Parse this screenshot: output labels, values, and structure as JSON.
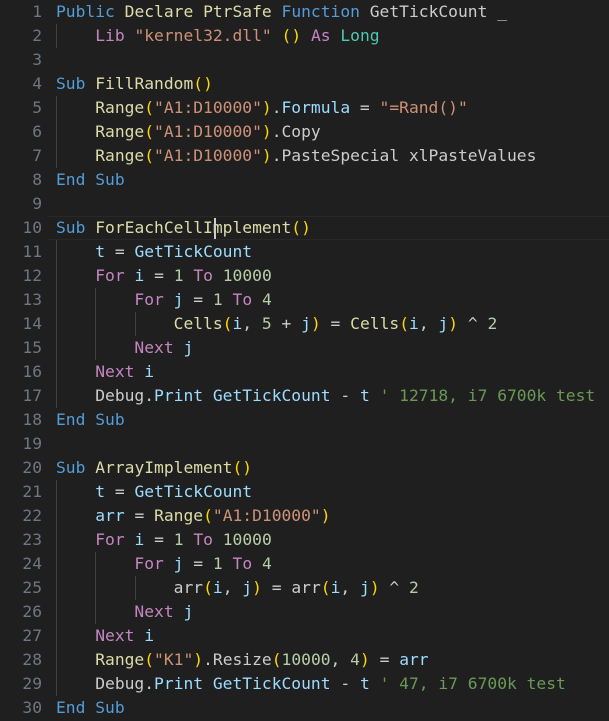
{
  "editor": {
    "background": "#1f1f1f",
    "line_number_color": "#6e7681",
    "caret": {
      "line": 10,
      "column": 16,
      "visible": true
    },
    "active_line": 10,
    "total_visible_lines": 30,
    "language": "vba",
    "colors": {
      "keyword_blue": "#569cd6",
      "keyword_pink": "#c586c0",
      "function_yellow": "#dcdcaa",
      "type_teal": "#4ec9b0",
      "string_orange": "#ce9178",
      "number_green": "#b5cea8",
      "variable_blue": "#9cdcfe",
      "comment_green": "#6a9955",
      "plain": "#cccccc",
      "bracket1": "#ffd700",
      "bracket2": "#da70d6",
      "bracket3": "#179fff"
    },
    "lines": [
      {
        "n": "1",
        "indent": 0,
        "text": "Public Declare PtrSafe Function GetTickCount _"
      },
      {
        "n": "2",
        "indent": 1,
        "text": "    Lib \"kernel32.dll\" () As Long"
      },
      {
        "n": "3",
        "indent": 0,
        "text": ""
      },
      {
        "n": "4",
        "indent": 0,
        "text": "Sub FillRandom()"
      },
      {
        "n": "5",
        "indent": 1,
        "text": "    Range(\"A1:D10000\").Formula = \"=Rand()\""
      },
      {
        "n": "6",
        "indent": 1,
        "text": "    Range(\"A1:D10000\").Copy"
      },
      {
        "n": "7",
        "indent": 1,
        "text": "    Range(\"A1:D10000\").PasteSpecial xlPasteValues"
      },
      {
        "n": "8",
        "indent": 0,
        "text": "End Sub"
      },
      {
        "n": "9",
        "indent": 0,
        "text": ""
      },
      {
        "n": "10",
        "indent": 0,
        "text": "Sub ForEachCellImplement()"
      },
      {
        "n": "11",
        "indent": 1,
        "text": "    t = GetTickCount"
      },
      {
        "n": "12",
        "indent": 1,
        "text": "    For i = 1 To 10000"
      },
      {
        "n": "13",
        "indent": 2,
        "text": "        For j = 1 To 4"
      },
      {
        "n": "14",
        "indent": 3,
        "text": "            Cells(i, 5 + j) = Cells(i, j) ^ 2"
      },
      {
        "n": "15",
        "indent": 2,
        "text": "        Next j"
      },
      {
        "n": "16",
        "indent": 1,
        "text": "    Next i"
      },
      {
        "n": "17",
        "indent": 1,
        "text": "    Debug.Print GetTickCount - t ' 12718, i7 6700k test"
      },
      {
        "n": "18",
        "indent": 0,
        "text": "End Sub"
      },
      {
        "n": "19",
        "indent": 0,
        "text": ""
      },
      {
        "n": "20",
        "indent": 0,
        "text": "Sub ArrayImplement()"
      },
      {
        "n": "21",
        "indent": 1,
        "text": "    t = GetTickCount"
      },
      {
        "n": "22",
        "indent": 1,
        "text": "    arr = Range(\"A1:D10000\")"
      },
      {
        "n": "23",
        "indent": 1,
        "text": "    For i = 1 To 10000"
      },
      {
        "n": "24",
        "indent": 2,
        "text": "        For j = 1 To 4"
      },
      {
        "n": "25",
        "indent": 3,
        "text": "            arr(i, j) = arr(i, j) ^ 2"
      },
      {
        "n": "26",
        "indent": 2,
        "text": "        Next j"
      },
      {
        "n": "27",
        "indent": 1,
        "text": "    Next i"
      },
      {
        "n": "28",
        "indent": 1,
        "text": "    Range(\"K1\").Resize(10000, 4) = arr"
      },
      {
        "n": "29",
        "indent": 1,
        "text": "    Debug.Print GetTickCount - t ' 47, i7 6700k test"
      },
      {
        "n": "30",
        "indent": 0,
        "text": "End Sub"
      }
    ],
    "tokens": [
      [
        {
          "t": "Public",
          "c": "kw"
        },
        {
          "t": " ",
          "c": "plain"
        },
        {
          "t": "Declare",
          "c": "fn"
        },
        {
          "t": " ",
          "c": "plain"
        },
        {
          "t": "PtrSafe",
          "c": "fn"
        },
        {
          "t": " ",
          "c": "plain"
        },
        {
          "t": "Function",
          "c": "kw"
        },
        {
          "t": " ",
          "c": "plain"
        },
        {
          "t": "GetTickCount",
          "c": "plain"
        },
        {
          "t": " ",
          "c": "plain"
        },
        {
          "t": "_",
          "c": "plain"
        }
      ],
      [
        {
          "t": "    ",
          "c": "plain"
        },
        {
          "t": "Lib",
          "c": "kw2"
        },
        {
          "t": " ",
          "c": "plain"
        },
        {
          "t": "\"kernel32.dll\"",
          "c": "str"
        },
        {
          "t": " ",
          "c": "plain"
        },
        {
          "t": "(",
          "c": "p1"
        },
        {
          "t": ")",
          "c": "p1"
        },
        {
          "t": " ",
          "c": "plain"
        },
        {
          "t": "As",
          "c": "kw2"
        },
        {
          "t": " ",
          "c": "plain"
        },
        {
          "t": "Long",
          "c": "type"
        }
      ],
      [],
      [
        {
          "t": "Sub",
          "c": "kw"
        },
        {
          "t": " ",
          "c": "plain"
        },
        {
          "t": "FillRandom",
          "c": "fn"
        },
        {
          "t": "(",
          "c": "p1"
        },
        {
          "t": ")",
          "c": "p1"
        }
      ],
      [
        {
          "t": "    ",
          "c": "plain"
        },
        {
          "t": "Range",
          "c": "fn"
        },
        {
          "t": "(",
          "c": "p1"
        },
        {
          "t": "\"A1:D10000\"",
          "c": "str"
        },
        {
          "t": ")",
          "c": "p1"
        },
        {
          "t": ".",
          "c": "plain"
        },
        {
          "t": "Formula",
          "c": "var"
        },
        {
          "t": " = ",
          "c": "plain"
        },
        {
          "t": "\"=Rand()\"",
          "c": "str"
        }
      ],
      [
        {
          "t": "    ",
          "c": "plain"
        },
        {
          "t": "Range",
          "c": "fn"
        },
        {
          "t": "(",
          "c": "p1"
        },
        {
          "t": "\"A1:D10000\"",
          "c": "str"
        },
        {
          "t": ")",
          "c": "p1"
        },
        {
          "t": ".",
          "c": "plain"
        },
        {
          "t": "Copy",
          "c": "plain"
        }
      ],
      [
        {
          "t": "    ",
          "c": "plain"
        },
        {
          "t": "Range",
          "c": "fn"
        },
        {
          "t": "(",
          "c": "p1"
        },
        {
          "t": "\"A1:D10000\"",
          "c": "str"
        },
        {
          "t": ")",
          "c": "p1"
        },
        {
          "t": ".",
          "c": "plain"
        },
        {
          "t": "PasteSpecial",
          "c": "plain"
        },
        {
          "t": " ",
          "c": "plain"
        },
        {
          "t": "xlPasteValues",
          "c": "plain"
        }
      ],
      [
        {
          "t": "End",
          "c": "kw"
        },
        {
          "t": " ",
          "c": "plain"
        },
        {
          "t": "Sub",
          "c": "kw"
        }
      ],
      [],
      [
        {
          "t": "Sub",
          "c": "kw"
        },
        {
          "t": " ",
          "c": "plain"
        },
        {
          "t": "ForEachCellImplement",
          "c": "fn"
        },
        {
          "t": "(",
          "c": "p1"
        },
        {
          "t": ")",
          "c": "p1"
        }
      ],
      [
        {
          "t": "    ",
          "c": "plain"
        },
        {
          "t": "t",
          "c": "var"
        },
        {
          "t": " = ",
          "c": "plain"
        },
        {
          "t": "GetTickCount",
          "c": "var"
        }
      ],
      [
        {
          "t": "    ",
          "c": "plain"
        },
        {
          "t": "For",
          "c": "kw2"
        },
        {
          "t": " ",
          "c": "plain"
        },
        {
          "t": "i",
          "c": "var"
        },
        {
          "t": " = ",
          "c": "plain"
        },
        {
          "t": "1",
          "c": "num"
        },
        {
          "t": " ",
          "c": "plain"
        },
        {
          "t": "To",
          "c": "kw2"
        },
        {
          "t": " ",
          "c": "plain"
        },
        {
          "t": "10000",
          "c": "num"
        }
      ],
      [
        {
          "t": "        ",
          "c": "plain"
        },
        {
          "t": "For",
          "c": "kw2"
        },
        {
          "t": " ",
          "c": "plain"
        },
        {
          "t": "j",
          "c": "var"
        },
        {
          "t": " = ",
          "c": "plain"
        },
        {
          "t": "1",
          "c": "num"
        },
        {
          "t": " ",
          "c": "plain"
        },
        {
          "t": "To",
          "c": "kw2"
        },
        {
          "t": " ",
          "c": "plain"
        },
        {
          "t": "4",
          "c": "num"
        }
      ],
      [
        {
          "t": "            ",
          "c": "plain"
        },
        {
          "t": "Cells",
          "c": "fn"
        },
        {
          "t": "(",
          "c": "p1"
        },
        {
          "t": "i",
          "c": "var"
        },
        {
          "t": ", ",
          "c": "plain"
        },
        {
          "t": "5",
          "c": "num"
        },
        {
          "t": " + ",
          "c": "plain"
        },
        {
          "t": "j",
          "c": "var"
        },
        {
          "t": ")",
          "c": "p1"
        },
        {
          "t": " = ",
          "c": "plain"
        },
        {
          "t": "Cells",
          "c": "fn"
        },
        {
          "t": "(",
          "c": "p1"
        },
        {
          "t": "i",
          "c": "var"
        },
        {
          "t": ", ",
          "c": "plain"
        },
        {
          "t": "j",
          "c": "var"
        },
        {
          "t": ")",
          "c": "p1"
        },
        {
          "t": " ^ ",
          "c": "plain"
        },
        {
          "t": "2",
          "c": "num"
        }
      ],
      [
        {
          "t": "        ",
          "c": "plain"
        },
        {
          "t": "Next",
          "c": "kw2"
        },
        {
          "t": " ",
          "c": "plain"
        },
        {
          "t": "j",
          "c": "var"
        }
      ],
      [
        {
          "t": "    ",
          "c": "plain"
        },
        {
          "t": "Next",
          "c": "kw2"
        },
        {
          "t": " ",
          "c": "plain"
        },
        {
          "t": "i",
          "c": "var"
        }
      ],
      [
        {
          "t": "    ",
          "c": "plain"
        },
        {
          "t": "Debug",
          "c": "plain"
        },
        {
          "t": ".",
          "c": "plain"
        },
        {
          "t": "Print",
          "c": "var"
        },
        {
          "t": " ",
          "c": "plain"
        },
        {
          "t": "GetTickCount",
          "c": "var"
        },
        {
          "t": " - ",
          "c": "plain"
        },
        {
          "t": "t",
          "c": "var"
        },
        {
          "t": " ",
          "c": "plain"
        },
        {
          "t": "' 12718, i7 6700k test",
          "c": "cmt"
        }
      ],
      [
        {
          "t": "End",
          "c": "kw"
        },
        {
          "t": " ",
          "c": "plain"
        },
        {
          "t": "Sub",
          "c": "kw"
        }
      ],
      [],
      [
        {
          "t": "Sub",
          "c": "kw"
        },
        {
          "t": " ",
          "c": "plain"
        },
        {
          "t": "ArrayImplement",
          "c": "fn"
        },
        {
          "t": "(",
          "c": "p1"
        },
        {
          "t": ")",
          "c": "p1"
        }
      ],
      [
        {
          "t": "    ",
          "c": "plain"
        },
        {
          "t": "t",
          "c": "var"
        },
        {
          "t": " = ",
          "c": "plain"
        },
        {
          "t": "GetTickCount",
          "c": "var"
        }
      ],
      [
        {
          "t": "    ",
          "c": "plain"
        },
        {
          "t": "arr",
          "c": "var"
        },
        {
          "t": " = ",
          "c": "plain"
        },
        {
          "t": "Range",
          "c": "fn"
        },
        {
          "t": "(",
          "c": "p1"
        },
        {
          "t": "\"A1:D10000\"",
          "c": "str"
        },
        {
          "t": ")",
          "c": "p1"
        }
      ],
      [
        {
          "t": "    ",
          "c": "plain"
        },
        {
          "t": "For",
          "c": "kw2"
        },
        {
          "t": " ",
          "c": "plain"
        },
        {
          "t": "i",
          "c": "var"
        },
        {
          "t": " = ",
          "c": "plain"
        },
        {
          "t": "1",
          "c": "num"
        },
        {
          "t": " ",
          "c": "plain"
        },
        {
          "t": "To",
          "c": "kw2"
        },
        {
          "t": " ",
          "c": "plain"
        },
        {
          "t": "10000",
          "c": "num"
        }
      ],
      [
        {
          "t": "        ",
          "c": "plain"
        },
        {
          "t": "For",
          "c": "kw2"
        },
        {
          "t": " ",
          "c": "plain"
        },
        {
          "t": "j",
          "c": "var"
        },
        {
          "t": " = ",
          "c": "plain"
        },
        {
          "t": "1",
          "c": "num"
        },
        {
          "t": " ",
          "c": "plain"
        },
        {
          "t": "To",
          "c": "kw2"
        },
        {
          "t": " ",
          "c": "plain"
        },
        {
          "t": "4",
          "c": "num"
        }
      ],
      [
        {
          "t": "            ",
          "c": "plain"
        },
        {
          "t": "arr",
          "c": "plain"
        },
        {
          "t": "(",
          "c": "p1"
        },
        {
          "t": "i",
          "c": "var"
        },
        {
          "t": ", ",
          "c": "plain"
        },
        {
          "t": "j",
          "c": "var"
        },
        {
          "t": ")",
          "c": "p1"
        },
        {
          "t": " = ",
          "c": "plain"
        },
        {
          "t": "arr",
          "c": "plain"
        },
        {
          "t": "(",
          "c": "p1"
        },
        {
          "t": "i",
          "c": "var"
        },
        {
          "t": ", ",
          "c": "plain"
        },
        {
          "t": "j",
          "c": "var"
        },
        {
          "t": ")",
          "c": "p1"
        },
        {
          "t": " ^ ",
          "c": "plain"
        },
        {
          "t": "2",
          "c": "num"
        }
      ],
      [
        {
          "t": "        ",
          "c": "plain"
        },
        {
          "t": "Next",
          "c": "kw2"
        },
        {
          "t": " ",
          "c": "plain"
        },
        {
          "t": "j",
          "c": "var"
        }
      ],
      [
        {
          "t": "    ",
          "c": "plain"
        },
        {
          "t": "Next",
          "c": "kw2"
        },
        {
          "t": " ",
          "c": "plain"
        },
        {
          "t": "i",
          "c": "var"
        }
      ],
      [
        {
          "t": "    ",
          "c": "plain"
        },
        {
          "t": "Range",
          "c": "fn"
        },
        {
          "t": "(",
          "c": "p1"
        },
        {
          "t": "\"K1\"",
          "c": "str"
        },
        {
          "t": ")",
          "c": "p1"
        },
        {
          "t": ".",
          "c": "plain"
        },
        {
          "t": "Resize",
          "c": "plain"
        },
        {
          "t": "(",
          "c": "p1"
        },
        {
          "t": "10000",
          "c": "num"
        },
        {
          "t": ", ",
          "c": "plain"
        },
        {
          "t": "4",
          "c": "num"
        },
        {
          "t": ")",
          "c": "p1"
        },
        {
          "t": " = ",
          "c": "plain"
        },
        {
          "t": "arr",
          "c": "var"
        }
      ],
      [
        {
          "t": "    ",
          "c": "plain"
        },
        {
          "t": "Debug",
          "c": "plain"
        },
        {
          "t": ".",
          "c": "plain"
        },
        {
          "t": "Print",
          "c": "var"
        },
        {
          "t": " ",
          "c": "plain"
        },
        {
          "t": "GetTickCount",
          "c": "var"
        },
        {
          "t": " - ",
          "c": "plain"
        },
        {
          "t": "t",
          "c": "var"
        },
        {
          "t": " ",
          "c": "plain"
        },
        {
          "t": "' 47, i7 6700k test",
          "c": "cmt"
        }
      ],
      [
        {
          "t": "End",
          "c": "kw"
        },
        {
          "t": " ",
          "c": "plain"
        },
        {
          "t": "Sub",
          "c": "kw"
        }
      ]
    ]
  }
}
